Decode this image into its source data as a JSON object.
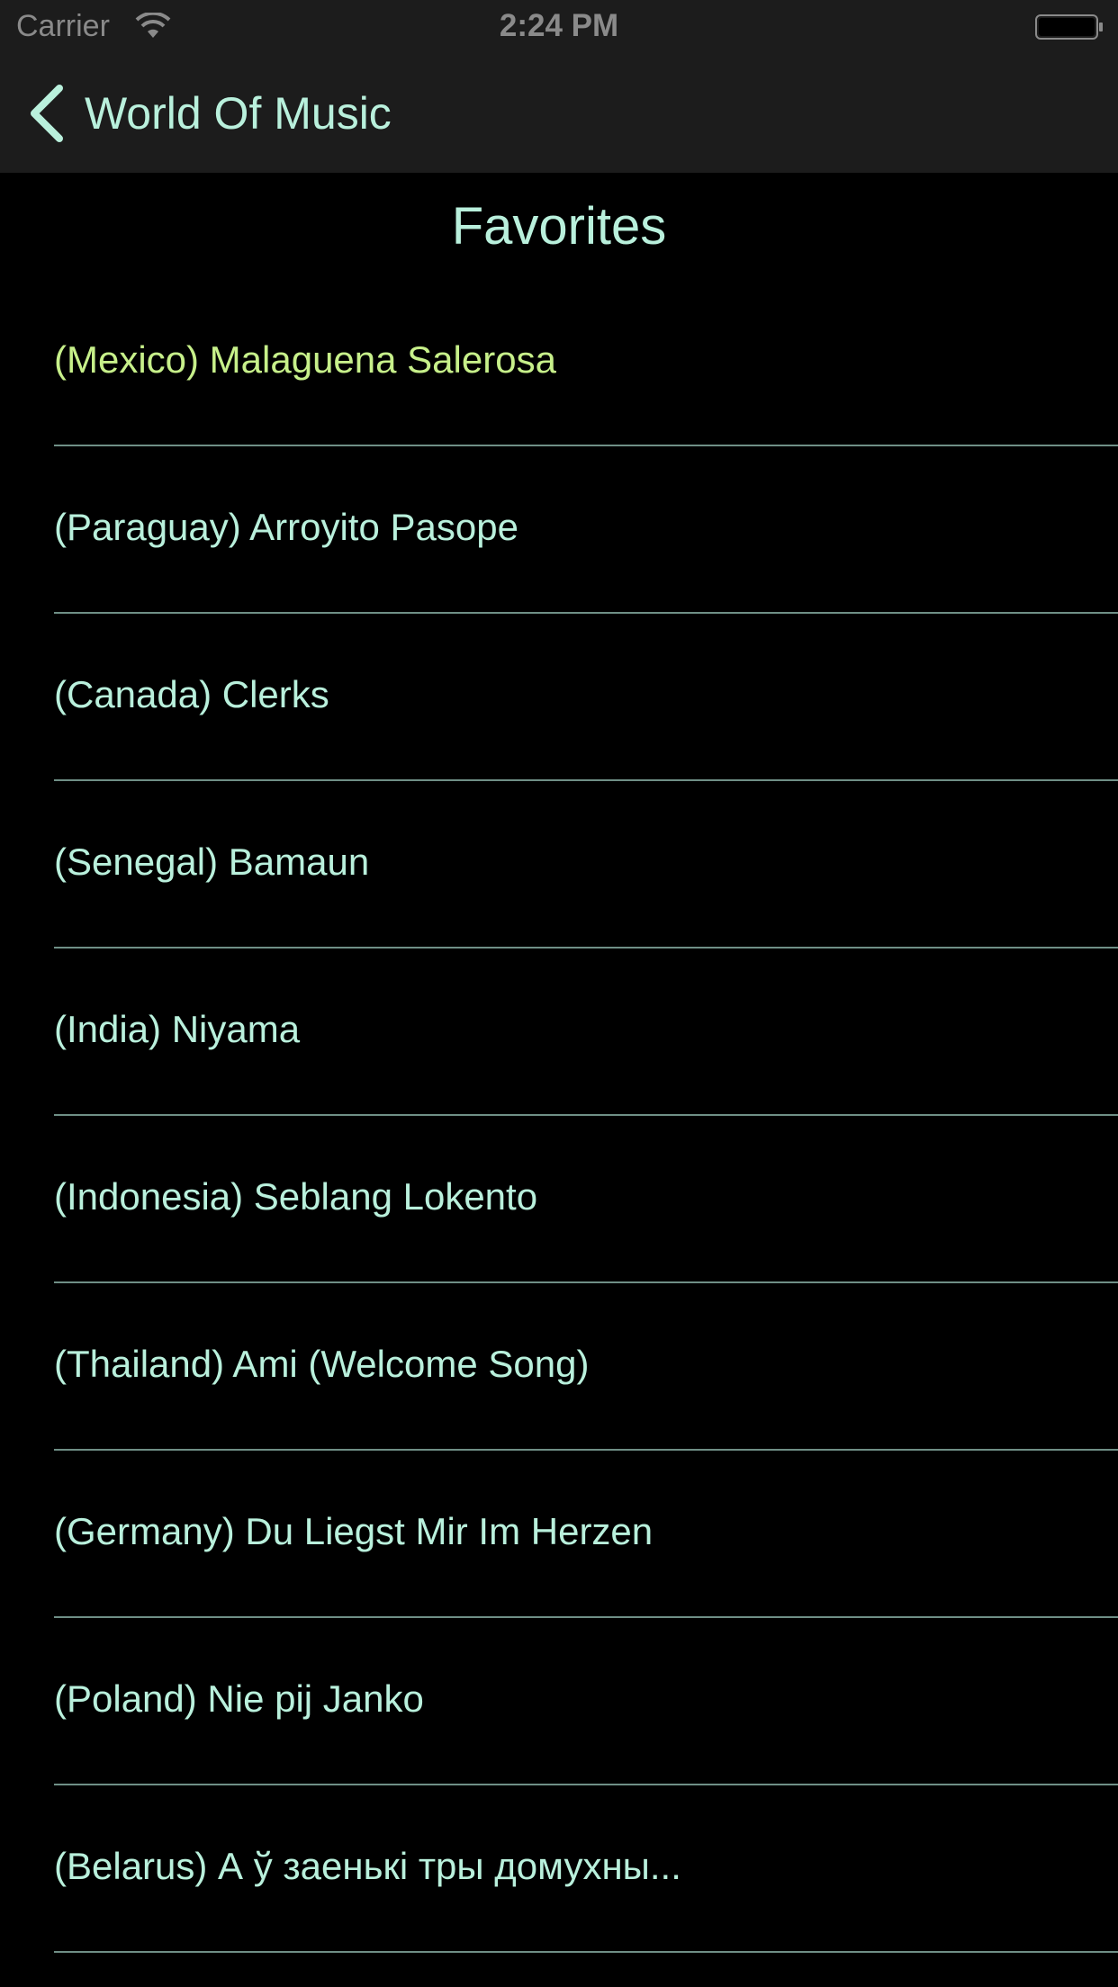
{
  "status_bar": {
    "carrier": "Carrier",
    "time": "2:24 PM"
  },
  "nav": {
    "back_label": "World Of Music"
  },
  "page": {
    "title": "Favorites"
  },
  "songs": [
    {
      "label": "(Mexico) Malaguena Salerosa",
      "selected": true
    },
    {
      "label": "(Paraguay) Arroyito Pasope",
      "selected": false
    },
    {
      "label": "(Canada) Clerks",
      "selected": false
    },
    {
      "label": "(Senegal) Bamaun",
      "selected": false
    },
    {
      "label": "(India) Niyama",
      "selected": false
    },
    {
      "label": "(Indonesia) Seblang Lokento",
      "selected": false
    },
    {
      "label": "(Thailand) Ami (Welcome Song)",
      "selected": false
    },
    {
      "label": "(Germany) Du Liegst Mir Im Herzen",
      "selected": false
    },
    {
      "label": "(Poland) Nie pij Janko",
      "selected": false
    },
    {
      "label": "(Belarus) А ў заенькі тры домухны...",
      "selected": false
    }
  ],
  "colors": {
    "accent_text": "#b9f0dc",
    "selected_text": "#c7f08a",
    "bar_background": "#1c1c1c",
    "background": "#000000"
  },
  "icons": [
    "wifi-icon",
    "battery-icon",
    "chevron-left-icon"
  ]
}
